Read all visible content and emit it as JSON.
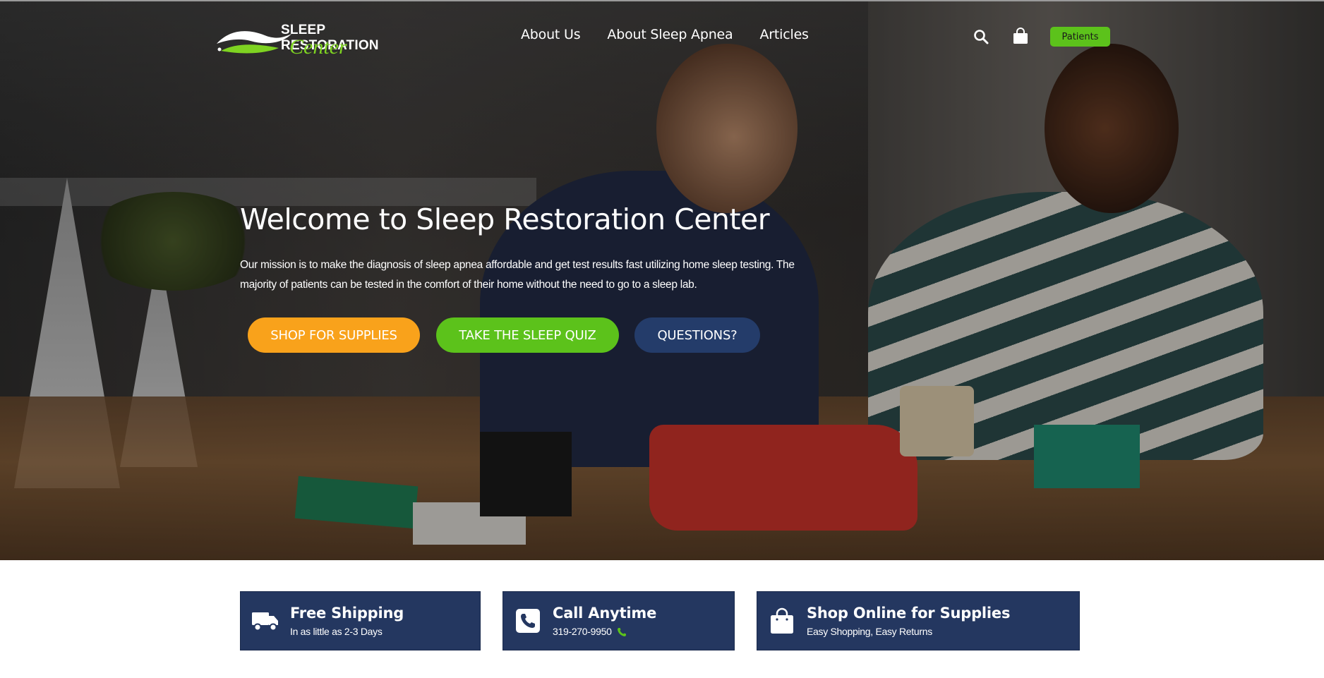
{
  "header": {
    "logo_top": "SLEEP RESTORATION",
    "logo_bottom": "Center",
    "nav": [
      "About Us",
      "About Sleep Apnea",
      "Articles"
    ],
    "icons": [
      "search-icon",
      "shopping-bag-icon"
    ],
    "patients_label": "Patients"
  },
  "hero": {
    "title": "Welcome to Sleep Restoration Center",
    "text": "Our mission is to make the diagnosis of sleep apnea affordable and get test results fast utilizing home sleep testing. The majority of patients can be tested in the comfort of their home without the need to go to a sleep lab.",
    "buttons": {
      "shop": "SHOP FOR SUPPLIES",
      "quiz": "TAKE THE SLEEP QUIZ",
      "questions": "QUESTIONS?"
    }
  },
  "features": [
    {
      "icon": "truck-icon",
      "title": "Free Shipping",
      "subtitle": "In as little as 2-3 Days"
    },
    {
      "icon": "phone-icon",
      "title": "Call Anytime",
      "subtitle": "319-270-9950"
    },
    {
      "icon": "shopping-bag-icon",
      "title": "Shop Online for Supplies",
      "subtitle": "Easy Shopping, Easy Returns"
    }
  ],
  "colors": {
    "orange": "#f9a21b",
    "green": "#5cc21b",
    "navy": "#243c6a",
    "feature_bg": "#243760"
  }
}
